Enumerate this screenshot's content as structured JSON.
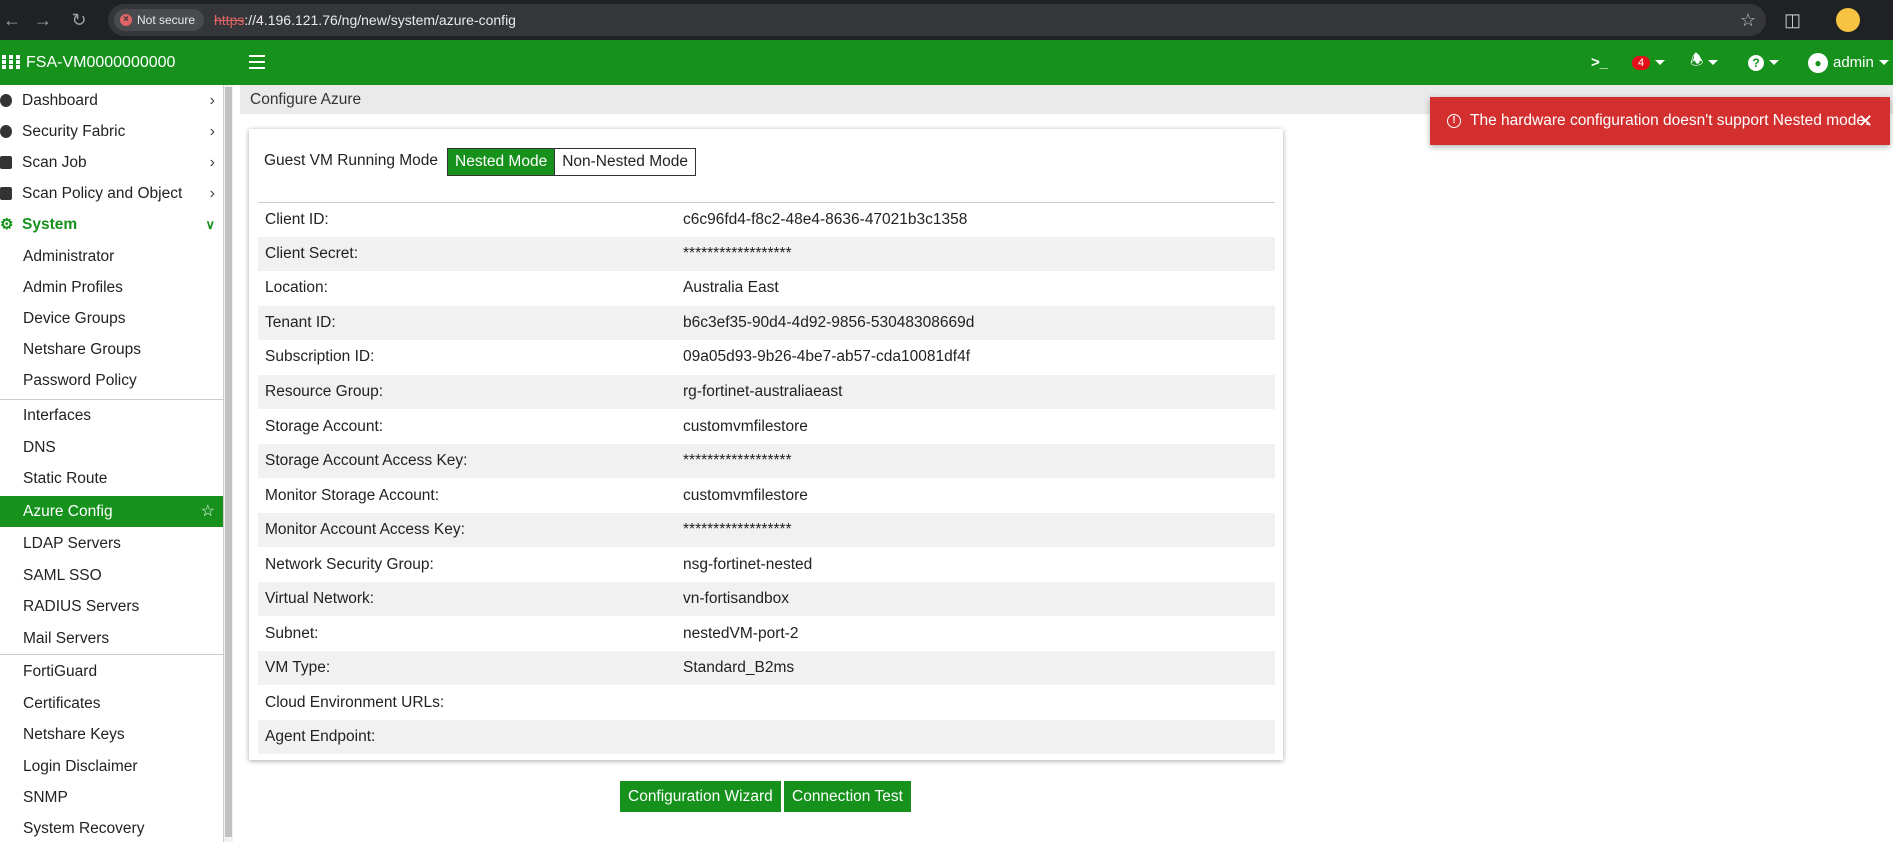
{
  "browser": {
    "security_label": "Not secure",
    "url_protocol": "https",
    "url_rest": "://4.196.121.76/ng/new/system/azure-config"
  },
  "header": {
    "hostname": "FSA-VM0000000000",
    "notification_count": "4",
    "user": "admin"
  },
  "sidebar": {
    "top_items": [
      {
        "label": "Dashboard"
      },
      {
        "label": "Security Fabric"
      },
      {
        "label": "Scan Job"
      },
      {
        "label": "Scan Policy and Object"
      }
    ],
    "section": {
      "label": "System"
    },
    "sub_items": [
      {
        "label": "Administrator"
      },
      {
        "label": "Admin Profiles"
      },
      {
        "label": "Device Groups"
      },
      {
        "label": "Netshare Groups"
      },
      {
        "label": "Password Policy"
      },
      {
        "label": "Interfaces"
      },
      {
        "label": "DNS"
      },
      {
        "label": "Static Route"
      },
      {
        "label": "Azure Config"
      },
      {
        "label": "LDAP Servers"
      },
      {
        "label": "SAML SSO"
      },
      {
        "label": "RADIUS Servers"
      },
      {
        "label": "Mail Servers"
      },
      {
        "label": "FortiGuard"
      },
      {
        "label": "Certificates"
      },
      {
        "label": "Netshare Keys"
      },
      {
        "label": "Login Disclaimer"
      },
      {
        "label": "SNMP"
      },
      {
        "label": "System Recovery"
      }
    ]
  },
  "page": {
    "title": "Configure Azure",
    "mode_label": "Guest VM Running Mode",
    "mode_nested": "Nested Mode",
    "mode_non_nested": "Non-Nested Mode",
    "selected_mode": "Nested Mode",
    "fields": [
      {
        "key": "Client ID:",
        "value": "c6c96fd4-f8c2-48e4-8636-47021b3c1358"
      },
      {
        "key": "Client Secret:",
        "value": "******************"
      },
      {
        "key": "Location:",
        "value": "Australia East"
      },
      {
        "key": "Tenant ID:",
        "value": "b6c3ef35-90d4-4d92-9856-53048308669d"
      },
      {
        "key": "Subscription ID:",
        "value": "09a05d93-9b26-4be7-ab57-cda10081df4f"
      },
      {
        "key": "Resource Group:",
        "value": "rg-fortinet-australiaeast"
      },
      {
        "key": "Storage Account:",
        "value": "customvmfilestore"
      },
      {
        "key": "Storage Account Access Key:",
        "value": "******************"
      },
      {
        "key": "Monitor Storage Account:",
        "value": "customvmfilestore"
      },
      {
        "key": "Monitor Account Access Key:",
        "value": "******************"
      },
      {
        "key": "Network Security Group:",
        "value": "nsg-fortinet-nested"
      },
      {
        "key": "Virtual Network:",
        "value": "vn-fortisandbox"
      },
      {
        "key": "Subnet:",
        "value": "nestedVM-port-2"
      },
      {
        "key": "VM Type:",
        "value": "Standard_B2ms"
      },
      {
        "key": "Cloud Environment URLs:",
        "value": ""
      },
      {
        "key": "Agent Endpoint:",
        "value": ""
      }
    ],
    "wizard_button": "Configuration Wizard",
    "test_button": "Connection Test"
  },
  "toast": {
    "message": "The hardware configuration doesn't support Nested mode."
  },
  "colors": {
    "brand_green": "#15911c",
    "error_red": "#d32f2f",
    "browser_dark": "#202124"
  }
}
